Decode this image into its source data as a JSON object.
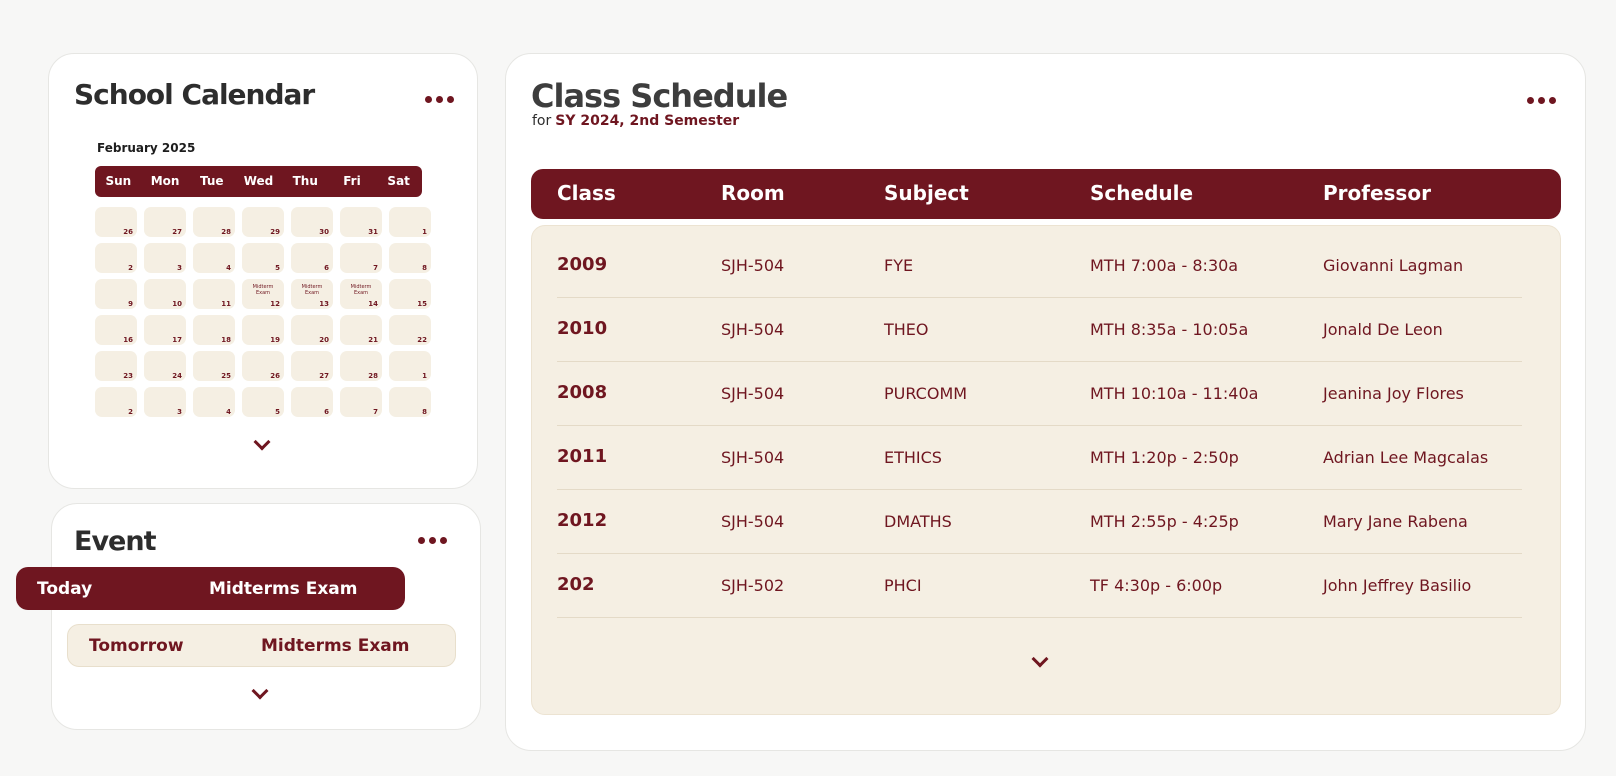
{
  "calendar": {
    "title": "School Calendar",
    "month": "February 2025",
    "weekdays": [
      "Sun",
      "Mon",
      "Tue",
      "Wed",
      "Thu",
      "Fri",
      "Sat"
    ],
    "days": [
      {
        "n": "26"
      },
      {
        "n": "27"
      },
      {
        "n": "28"
      },
      {
        "n": "29"
      },
      {
        "n": "30"
      },
      {
        "n": "31"
      },
      {
        "n": "1"
      },
      {
        "n": "2"
      },
      {
        "n": "3"
      },
      {
        "n": "4"
      },
      {
        "n": "5"
      },
      {
        "n": "6"
      },
      {
        "n": "7"
      },
      {
        "n": "8"
      },
      {
        "n": "9"
      },
      {
        "n": "10"
      },
      {
        "n": "11"
      },
      {
        "n": "12",
        "event": "Midterm Exam"
      },
      {
        "n": "13",
        "event": "Midterm Exam"
      },
      {
        "n": "14",
        "event": "Midterm Exam"
      },
      {
        "n": "15"
      },
      {
        "n": "16"
      },
      {
        "n": "17"
      },
      {
        "n": "18"
      },
      {
        "n": "19"
      },
      {
        "n": "20"
      },
      {
        "n": "21"
      },
      {
        "n": "22"
      },
      {
        "n": "23"
      },
      {
        "n": "24"
      },
      {
        "n": "25"
      },
      {
        "n": "26"
      },
      {
        "n": "27"
      },
      {
        "n": "28"
      },
      {
        "n": "1"
      },
      {
        "n": "2"
      },
      {
        "n": "3"
      },
      {
        "n": "4"
      },
      {
        "n": "5"
      },
      {
        "n": "6"
      },
      {
        "n": "7"
      },
      {
        "n": "8"
      }
    ]
  },
  "event": {
    "title": "Event",
    "items": [
      {
        "when": "Today",
        "what": "Midterms Exam"
      },
      {
        "when": "Tomorrow",
        "what": "Midterms Exam"
      }
    ]
  },
  "schedule": {
    "title": "Class Schedule",
    "subtitle_prefix": "for",
    "subtitle_term": "SY 2024, 2nd Semester",
    "columns": [
      "Class",
      "Room",
      "Subject",
      "Schedule",
      "Professor"
    ],
    "rows": [
      {
        "class": "2009",
        "room": "SJH-504",
        "subject": "FYE",
        "schedule": "MTH 7:00a - 8:30a",
        "professor": "Giovanni Lagman"
      },
      {
        "class": "2010",
        "room": "SJH-504",
        "subject": "THEO",
        "schedule": "MTH 8:35a - 10:05a",
        "professor": "Jonald De Leon"
      },
      {
        "class": "2008",
        "room": "SJH-504",
        "subject": "PURCOMM",
        "schedule": "MTH 10:10a - 11:40a",
        "professor": "Jeanina Joy Flores"
      },
      {
        "class": "2011",
        "room": "SJH-504",
        "subject": "ETHICS",
        "schedule": "MTH 1:20p - 2:50p",
        "professor": "Adrian Lee Magcalas"
      },
      {
        "class": "2012",
        "room": "SJH-504",
        "subject": "DMATHS",
        "schedule": "MTH 2:55p - 4:25p",
        "professor": "Mary Jane Rabena"
      },
      {
        "class": "202",
        "room": "SJH-502",
        "subject": "PHCI",
        "schedule": "TF 4:30p - 6:00p",
        "professor": "John Jeffrey Basilio"
      }
    ]
  },
  "icons": {
    "more": "more-dots-icon",
    "expand": "chevron-down-icon"
  },
  "colors": {
    "accent": "#6f1620",
    "cream": "#f5efe3",
    "background": "#f7f7f6"
  }
}
